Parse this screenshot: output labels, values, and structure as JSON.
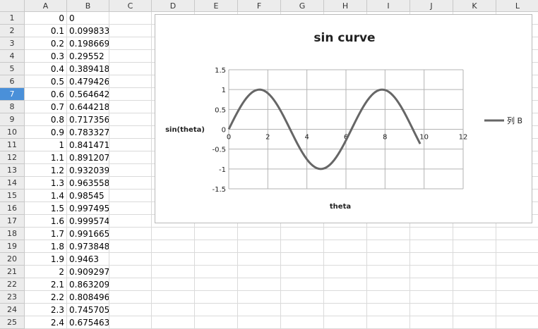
{
  "columns": [
    "A",
    "B",
    "C",
    "D",
    "E",
    "F",
    "G",
    "H",
    "I",
    "J",
    "K",
    "L"
  ],
  "rows": [
    {
      "num": "1",
      "a": "0",
      "b": "0"
    },
    {
      "num": "2",
      "a": "0.1",
      "b": "0.099833"
    },
    {
      "num": "3",
      "a": "0.2",
      "b": "0.198669"
    },
    {
      "num": "4",
      "a": "0.3",
      "b": "0.29552"
    },
    {
      "num": "5",
      "a": "0.4",
      "b": "0.389418"
    },
    {
      "num": "6",
      "a": "0.5",
      "b": "0.479426"
    },
    {
      "num": "7",
      "a": "0.6",
      "b": "0.564642"
    },
    {
      "num": "8",
      "a": "0.7",
      "b": "0.644218"
    },
    {
      "num": "9",
      "a": "0.8",
      "b": "0.717356"
    },
    {
      "num": "10",
      "a": "0.9",
      "b": "0.783327"
    },
    {
      "num": "11",
      "a": "1",
      "b": "0.841471"
    },
    {
      "num": "12",
      "a": "1.1",
      "b": "0.891207"
    },
    {
      "num": "13",
      "a": "1.2",
      "b": "0.932039"
    },
    {
      "num": "14",
      "a": "1.3",
      "b": "0.963558"
    },
    {
      "num": "15",
      "a": "1.4",
      "b": "0.98545"
    },
    {
      "num": "16",
      "a": "1.5",
      "b": "0.997495"
    },
    {
      "num": "17",
      "a": "1.6",
      "b": "0.999574"
    },
    {
      "num": "18",
      "a": "1.7",
      "b": "0.991665"
    },
    {
      "num": "19",
      "a": "1.8",
      "b": "0.973848"
    },
    {
      "num": "20",
      "a": "1.9",
      "b": "0.9463"
    },
    {
      "num": "21",
      "a": "2",
      "b": "0.909297"
    },
    {
      "num": "22",
      "a": "2.1",
      "b": "0.863209"
    },
    {
      "num": "23",
      "a": "2.2",
      "b": "0.808496"
    },
    {
      "num": "24",
      "a": "2.3",
      "b": "0.745705"
    },
    {
      "num": "25",
      "a": "2.4",
      "b": "0.675463"
    }
  ],
  "selected_row": "7",
  "chart_data": {
    "type": "line",
    "title": "sin curve",
    "xlabel": "theta",
    "ylabel": "sin(theta)",
    "xlim": [
      0,
      12
    ],
    "ylim": [
      -1.5,
      1.5
    ],
    "x_ticks": [
      "0",
      "2",
      "4",
      "6",
      "8",
      "10",
      "12"
    ],
    "y_ticks": [
      "1.5",
      "1",
      "0.5",
      "0",
      "-0.5",
      "-1",
      "-1.5"
    ],
    "x_tick_values": [
      0,
      2,
      4,
      6,
      8,
      10,
      12
    ],
    "y_tick_values": [
      1.5,
      1,
      0.5,
      0,
      -0.5,
      -1,
      -1.5
    ],
    "grid": true,
    "legend_position": "right",
    "series": [
      {
        "name": "列 B",
        "color": "#666666",
        "x_start": 0,
        "x_step": 0.1,
        "x_end": 9.8,
        "function": "sin"
      }
    ]
  }
}
